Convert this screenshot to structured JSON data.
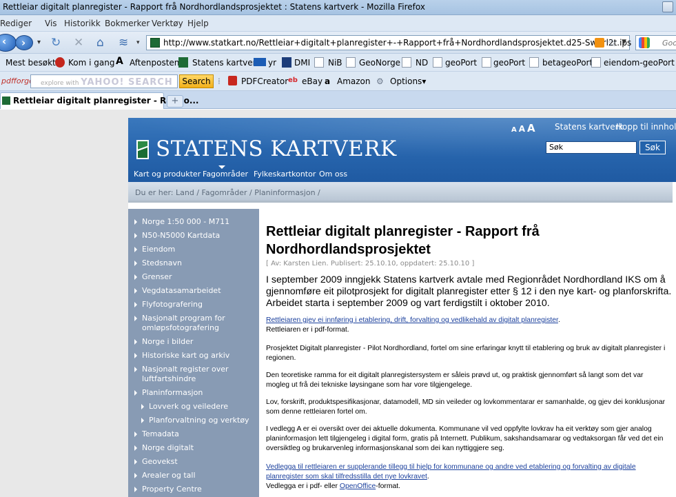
{
  "window": {
    "title": "Rettleiar digitalt planregister - Rapport frå Nordhordlandsprosjektet : Statens kartverk - Mozilla Firefox"
  },
  "menu": [
    "Rediger",
    "Vis",
    "Historikk",
    "Bokmerker",
    "Verktøy",
    "Hjelp"
  ],
  "url": "http://www.statkart.no/Rettleiar+digitalt+planregister+-+Rapport+frå+Nordhordlandsprosjektet.d25-SwRrl2t.ips",
  "browser_search": {
    "placeholder": "Goo"
  },
  "bookmarks": [
    "Mest besøkt",
    "Kom i gang",
    "Aftenposten",
    "Statens kartverk",
    "yr",
    "DMI",
    "NiB",
    "GeoNorge",
    "ND",
    "geoPort",
    "geoPort",
    "betageoPort",
    "eiendom-geoPort"
  ],
  "yahoo_toolbar": {
    "brand": "pdfforge",
    "placeholder_small": "explore with",
    "placeholder_big": "YAHOO! SEARCH",
    "search_btn": "Search",
    "pdfcreator": "PDFCreator",
    "ebay": "eBay",
    "amazon": "Amazon",
    "options": "Options"
  },
  "tab": {
    "label": "Rettleiar digitalt planregister - Rappo..."
  },
  "site": {
    "logo": "STATENS KARTVERK",
    "font_sizes": [
      "A",
      "A",
      "A"
    ],
    "top_links": [
      "Statens kartverk",
      "Hopp til innhold"
    ],
    "search_value": "Søk",
    "search_btn": "Søk",
    "nav": [
      "Kart og produkter",
      "Fagområder",
      "Fylkeskartkontor",
      "Om oss"
    ],
    "breadcrumb": "Du er her: Land / Fagområder / Planinformasjon /"
  },
  "leftnav": [
    {
      "label": "Norge 1:50 000 - M711",
      "sub": false
    },
    {
      "label": "N50-N5000 Kartdata",
      "sub": false
    },
    {
      "label": "Eiendom",
      "sub": false
    },
    {
      "label": "Stedsnavn",
      "sub": false
    },
    {
      "label": "Grenser",
      "sub": false
    },
    {
      "label": "Vegdatasamarbeidet",
      "sub": false
    },
    {
      "label": "Flyfotografering",
      "sub": false
    },
    {
      "label": "Nasjonalt program for\nomløpsfotografering",
      "sub": false
    },
    {
      "label": "Norge i bilder",
      "sub": false
    },
    {
      "label": "Historiske kart og arkiv",
      "sub": false
    },
    {
      "label": "Nasjonalt register over\nluftfartshindre",
      "sub": false
    },
    {
      "label": "Planinformasjon",
      "sub": false
    },
    {
      "label": "Lovverk og veiledere",
      "sub": true
    },
    {
      "label": "Planforvaltning og verktøy",
      "sub": true
    },
    {
      "label": "Temadata",
      "sub": false
    },
    {
      "label": "Norge digitalt",
      "sub": false
    },
    {
      "label": "Geovekst",
      "sub": false
    },
    {
      "label": "Arealer og tall",
      "sub": false
    },
    {
      "label": "Property Centre",
      "sub": false
    }
  ],
  "article": {
    "title": "Rettleiar digitalt planregister - Rapport frå Nordhordlandsprosjektet",
    "meta": "[ Av: Karsten Lien. Publisert: 25.10.10, oppdatert: 25.10.10 ]",
    "lead": "I september 2009 inngjekk Statens kartverk avtale med Regionrådet Nordhordland IKS om å gjennomføre eit pilotprosjekt for digitalt planregister etter § 12 i den nye kart- og planforskrifta. Arbeidet starta i september 2009 og vart ferdigstilt i oktober 2010.",
    "link1": "Rettleiaren gjev ei innføring i etablering, drift, forvalting og vedlikehald av digitalt planregister",
    "link1_after": ".",
    "p1b": "Rettleiaren er i pdf-format.",
    "p2": "Prosjektet Digitalt planregister - Pilot Nordhordland, fortel om sine erfaringar knytt til etablering og bruk av digitalt planregister i regionen.",
    "p3": "Den teoretiske ramma for eit digitalt planregistersystem er såleis prøvd ut, og praktisk gjennomført så langt som det var mogleg ut frå dei tekniske løysingane som har vore tilgjengelege.",
    "p4": "Lov, forskrift, produktspesifikasjonar, datamodell, MD sin veileder og lovkommentarar er samanhalde, og gjev dei konklusjonar som denne rettleiaren fortel om.",
    "p5": "I vedlegg A er ei oversikt over dei aktuelle dokumenta. Kommunane vil ved oppfylte lovkrav ha eit verktøy som gjer analog planinformasjon lett tilgjengeleg i digital form, gratis på Internett. Publikum, sakshandsamarar og vedtaksorgan får ved det ein oversiktleg og brukarvenleg informasjonskanal som dei kan nyttiggjere seg.",
    "link2": "Vedlegga til rettleiaren er supplerande tillegg til hjelp for kommunane og andre ved etablering og forvalting av digitale planregister som skal tilfredsstilla det nye lovkravet",
    "link2_after": ".",
    "p6a": "Vedlegga er i pdf- eller ",
    "p6link": "OpenOffice",
    "p6b": "-format."
  },
  "colors": {
    "header_blue": "#2866ae",
    "leftnav": "#889bb4",
    "link": "#1a3f9c"
  }
}
